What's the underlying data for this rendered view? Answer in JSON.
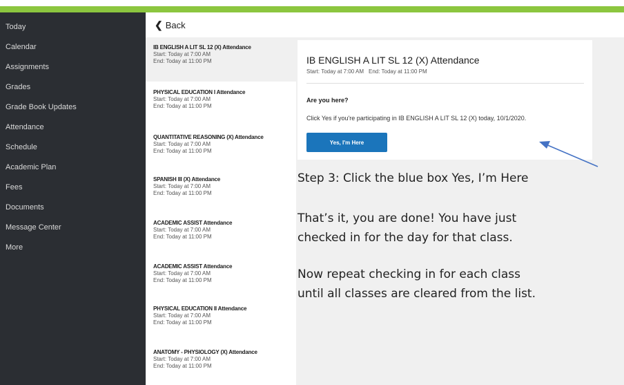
{
  "sidebar": {
    "items": [
      {
        "label": "Today"
      },
      {
        "label": "Calendar"
      },
      {
        "label": "Assignments"
      },
      {
        "label": "Grades"
      },
      {
        "label": "Grade Book Updates"
      },
      {
        "label": "Attendance"
      },
      {
        "label": "Schedule"
      },
      {
        "label": "Academic Plan"
      },
      {
        "label": "Fees"
      },
      {
        "label": "Documents"
      },
      {
        "label": "Message Center"
      },
      {
        "label": "More"
      }
    ]
  },
  "header": {
    "back_label": "Back"
  },
  "attendance_list": [
    {
      "title": "IB ENGLISH A LIT SL 12 (X) Attendance",
      "start": "Start: Today at 7:00 AM",
      "end": "End: Today at 11:00 PM"
    },
    {
      "title": "PHYSICAL EDUCATION I Attendance",
      "start": "Start: Today at 7:00 AM",
      "end": "End: Today at 11:00 PM"
    },
    {
      "title": "QUANTITATIVE REASONING (X) Attendance",
      "start": "Start: Today at 7:00 AM",
      "end": "End: Today at 11:00 PM"
    },
    {
      "title": "SPANISH III (X) Attendance",
      "start": "Start: Today at 7:00 AM",
      "end": "End: Today at 11:00 PM"
    },
    {
      "title": "ACADEMIC ASSIST Attendance",
      "start": "Start: Today at 7:00 AM",
      "end": "End: Today at 11:00 PM"
    },
    {
      "title": "ACADEMIC ASSIST Attendance",
      "start": "Start: Today at 7:00 AM",
      "end": "End: Today at 11:00 PM"
    },
    {
      "title": "PHYSICAL EDUCATION II Attendance",
      "start": "Start: Today at 7:00 AM",
      "end": "End: Today at 11:00 PM"
    },
    {
      "title": "ANATOMY - PHYSIOLOGY (X) Attendance",
      "start": "Start: Today at 7:00 AM",
      "end": "End: Today at 11:00 PM"
    }
  ],
  "detail": {
    "title": "IB ENGLISH A LIT SL 12 (X) Attendance",
    "start": "Start: Today at 7:00 AM",
    "end": "End: Today at 11:00 PM",
    "question": "Are you here?",
    "instruction": "Click Yes if you're participating in IB ENGLISH A LIT SL 12 (X) today, 10/1/2020.",
    "button_label": "Yes, I'm Here"
  },
  "annotations": {
    "step3": "Step 3: Click the blue box Yes, I’m Here",
    "done_line1": "That’s it, you are done! You have just",
    "done_line2": "checked in for the day for that class.",
    "repeat_line1": "Now repeat checking in for each class",
    "repeat_line2": "until all classes are cleared from the list."
  },
  "colors": {
    "top_bar": "#8cc63f",
    "sidebar_bg": "#2b2e33",
    "button_blue": "#1b75bb",
    "arrow_blue": "#4472c4"
  }
}
